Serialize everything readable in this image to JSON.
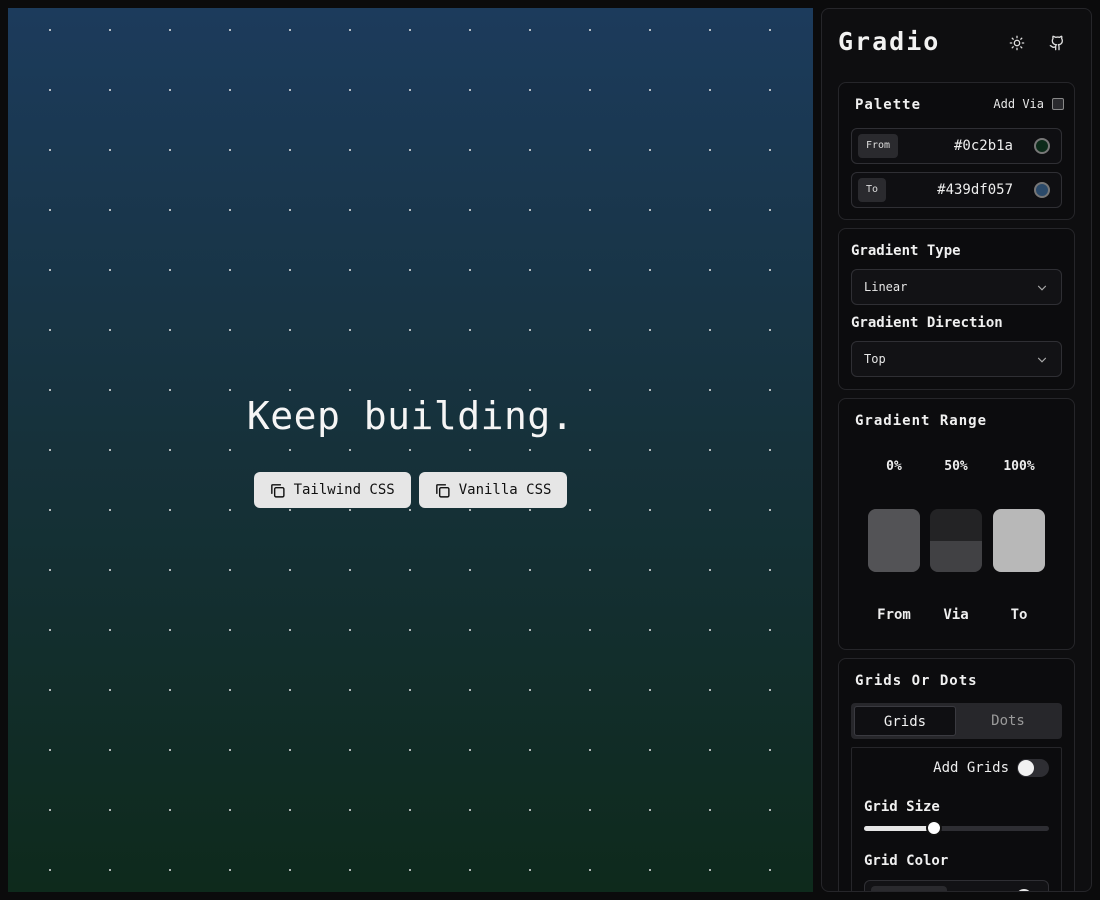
{
  "preview": {
    "heading": "Keep building.",
    "buttons": {
      "tailwind": "Tailwind CSS",
      "vanilla": "Vanilla CSS"
    },
    "gradient": {
      "from": "#0e2a1c",
      "to": "#1c3b5c",
      "direction": "Top"
    },
    "dot_color": "#e6e6e6"
  },
  "sidebar": {
    "brand": "Gradio",
    "header_icons": [
      "sun-icon",
      "github-icon"
    ],
    "palette": {
      "title": "Palette",
      "add_via_label": "Add Via",
      "add_via_checked": false,
      "from": {
        "tag": "From",
        "value": "#0c2b1a",
        "swatch": "#0c2b1a"
      },
      "to": {
        "tag": "To",
        "value": "#439df057",
        "swatch": "#2b4a6a"
      }
    },
    "gradient_settings": {
      "type_label": "Gradient Type",
      "type_value": "Linear",
      "direction_label": "Gradient Direction",
      "direction_value": "Top"
    },
    "gradient_range": {
      "title": "Gradient Range",
      "stops": [
        {
          "percent": "0%",
          "label": "From",
          "fill": 1.0
        },
        {
          "percent": "50%",
          "label": "Via",
          "fill": 0.5
        },
        {
          "percent": "100%",
          "label": "To",
          "fill": 1.0
        }
      ]
    },
    "grids_or_dots": {
      "title": "Grids Or Dots",
      "tabs": [
        "Grids",
        "Dots"
      ],
      "active_tab": "Grids",
      "add_grids_label": "Add Grids",
      "add_grids_on": false,
      "grid_size_label": "Grid Size",
      "grid_size_value": 0.38,
      "grid_color_label": "Grid Color"
    }
  }
}
